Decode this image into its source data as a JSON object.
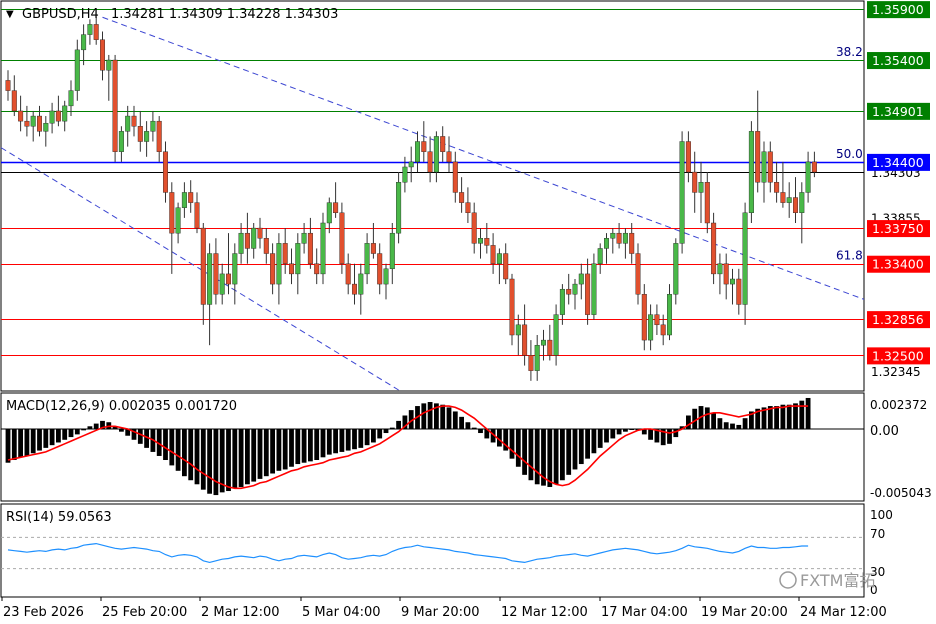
{
  "header": {
    "symbol_tf": "GBPUSD,H4",
    "ohlc": "1.34281 1.34309 1.34228 1.34303"
  },
  "macd_label": "MACD(12,26,9) 0.002035 0.001720",
  "rsi_label": "RSI(14) 59.0563",
  "watermark": "FXTM富拓",
  "colors": {
    "bull": "#49b848",
    "bear": "#e1502e",
    "support": "#ff0000",
    "resistance": "#008000",
    "fib": "#000080",
    "pivot": "#0000ff",
    "channel": "#3c46d2",
    "macd_signal": "#ff0000",
    "rsi_line": "#1e90ff"
  },
  "price_tags": [
    {
      "label": "1.35900",
      "price": 1.359,
      "color": "#008000"
    },
    {
      "label": "1.35400",
      "price": 1.354,
      "color": "#008000"
    },
    {
      "label": "1.34901",
      "price": 1.34901,
      "color": "#008000"
    },
    {
      "label": "1.34400",
      "price": 1.344,
      "color": "#0000ff"
    },
    {
      "label": "1.33750",
      "price": 1.3375,
      "color": "#ff0000"
    },
    {
      "label": "1.33400",
      "price": 1.334,
      "color": "#ff0000"
    },
    {
      "label": "1.32856",
      "price": 1.32856,
      "color": "#ff0000"
    },
    {
      "label": "1.32500",
      "price": 1.325,
      "color": "#ff0000"
    }
  ],
  "axis_prices": [
    {
      "label": "1.34303",
      "price": 1.34303
    },
    {
      "label": "1.33855",
      "price": 1.33855
    },
    {
      "label": "1.32345",
      "price": 1.32345
    }
  ],
  "fib_labels": [
    {
      "label": "38.2",
      "price": 1.354
    },
    {
      "label": "50.0",
      "price": 1.344
    },
    {
      "label": "61.8",
      "price": 1.334
    }
  ],
  "macd_axis": [
    "0.002372",
    "0.00",
    "-0.005043"
  ],
  "rsi_axis": [
    "100",
    "70",
    "30",
    "0"
  ],
  "x_labels": [
    "23 Feb 2026",
    "25 Feb 20:00",
    "2 Mar 12:00",
    "5 Mar 04:00",
    "9 Mar 20:00",
    "12 Mar 12:00",
    "17 Mar 04:00",
    "19 Mar 20:00",
    "24 Mar 12:00"
  ],
  "chart_data": {
    "type": "candlestick",
    "instrument": "GBPUSD",
    "timeframe": "H4",
    "price_range": [
      1.3216,
      1.3597
    ],
    "candles": [
      [
        1.352,
        1.353,
        1.35,
        1.351
      ],
      [
        1.351,
        1.3525,
        1.3485,
        1.349
      ],
      [
        1.349,
        1.3505,
        1.347,
        1.348
      ],
      [
        1.348,
        1.3495,
        1.3465,
        1.3475
      ],
      [
        1.3475,
        1.349,
        1.346,
        1.3485
      ],
      [
        1.3485,
        1.3495,
        1.3465,
        1.347
      ],
      [
        1.347,
        1.3485,
        1.3455,
        1.3478
      ],
      [
        1.3478,
        1.3498,
        1.3468,
        1.349
      ],
      [
        1.349,
        1.3505,
        1.3475,
        1.348
      ],
      [
        1.348,
        1.35,
        1.347,
        1.3495
      ],
      [
        1.3495,
        1.352,
        1.3485,
        1.351
      ],
      [
        1.351,
        1.356,
        1.35,
        1.355
      ],
      [
        1.355,
        1.3575,
        1.3535,
        1.3565
      ],
      [
        1.3565,
        1.358,
        1.3555,
        1.3575
      ],
      [
        1.3575,
        1.3582,
        1.3555,
        1.356
      ],
      [
        1.356,
        1.3568,
        1.352,
        1.353
      ],
      [
        1.353,
        1.3545,
        1.35,
        1.354
      ],
      [
        1.354,
        1.3545,
        1.344,
        1.345
      ],
      [
        1.345,
        1.3475,
        1.344,
        1.347
      ],
      [
        1.347,
        1.3495,
        1.3455,
        1.3485
      ],
      [
        1.3485,
        1.3495,
        1.3465,
        1.3475
      ],
      [
        1.3475,
        1.349,
        1.345,
        1.346
      ],
      [
        1.346,
        1.348,
        1.3445,
        1.347
      ],
      [
        1.347,
        1.349,
        1.346,
        1.348
      ],
      [
        1.348,
        1.3485,
        1.344,
        1.345
      ],
      [
        1.345,
        1.346,
        1.34,
        1.341
      ],
      [
        1.341,
        1.342,
        1.333,
        1.337
      ],
      [
        1.337,
        1.34,
        1.336,
        1.3395
      ],
      [
        1.3395,
        1.342,
        1.3385,
        1.341
      ],
      [
        1.341,
        1.3422,
        1.339,
        1.34
      ],
      [
        1.34,
        1.341,
        1.337,
        1.3375
      ],
      [
        1.3375,
        1.338,
        1.328,
        1.33
      ],
      [
        1.33,
        1.336,
        1.326,
        1.335
      ],
      [
        1.335,
        1.3365,
        1.33,
        1.331
      ],
      [
        1.331,
        1.334,
        1.33,
        1.333
      ],
      [
        1.333,
        1.337,
        1.331,
        1.332
      ],
      [
        1.332,
        1.336,
        1.33,
        1.335
      ],
      [
        1.335,
        1.338,
        1.334,
        1.337
      ],
      [
        1.337,
        1.339,
        1.334,
        1.3355
      ],
      [
        1.3355,
        1.338,
        1.3345,
        1.3375
      ],
      [
        1.3375,
        1.3385,
        1.3355,
        1.3365
      ],
      [
        1.3365,
        1.3375,
        1.334,
        1.335
      ],
      [
        1.335,
        1.336,
        1.331,
        1.332
      ],
      [
        1.332,
        1.337,
        1.33,
        1.336
      ],
      [
        1.336,
        1.3375,
        1.333,
        1.334
      ],
      [
        1.334,
        1.3355,
        1.332,
        1.333
      ],
      [
        1.333,
        1.337,
        1.331,
        1.336
      ],
      [
        1.336,
        1.338,
        1.335,
        1.337
      ],
      [
        1.337,
        1.3385,
        1.3335,
        1.334
      ],
      [
        1.334,
        1.3355,
        1.332,
        1.333
      ],
      [
        1.333,
        1.339,
        1.332,
        1.338
      ],
      [
        1.338,
        1.3405,
        1.337,
        1.34
      ],
      [
        1.34,
        1.342,
        1.3385,
        1.339
      ],
      [
        1.339,
        1.34,
        1.333,
        1.334
      ],
      [
        1.334,
        1.335,
        1.331,
        1.332
      ],
      [
        1.332,
        1.334,
        1.33,
        1.331
      ],
      [
        1.331,
        1.334,
        1.329,
        1.333
      ],
      [
        1.333,
        1.337,
        1.332,
        1.336
      ],
      [
        1.336,
        1.338,
        1.3345,
        1.335
      ],
      [
        1.335,
        1.336,
        1.331,
        1.332
      ],
      [
        1.332,
        1.334,
        1.3305,
        1.3335
      ],
      [
        1.3335,
        1.338,
        1.332,
        1.337
      ],
      [
        1.337,
        1.343,
        1.336,
        1.342
      ],
      [
        1.342,
        1.3445,
        1.341,
        1.3435
      ],
      [
        1.3435,
        1.3455,
        1.342,
        1.344
      ],
      [
        1.344,
        1.347,
        1.343,
        1.346
      ],
      [
        1.346,
        1.348,
        1.344,
        1.345
      ],
      [
        1.345,
        1.3465,
        1.342,
        1.343
      ],
      [
        1.343,
        1.347,
        1.342,
        1.3465
      ],
      [
        1.3465,
        1.3475,
        1.344,
        1.345
      ],
      [
        1.345,
        1.3465,
        1.343,
        1.344
      ],
      [
        1.344,
        1.345,
        1.34,
        1.341
      ],
      [
        1.341,
        1.3425,
        1.339,
        1.34
      ],
      [
        1.34,
        1.3415,
        1.338,
        1.339
      ],
      [
        1.339,
        1.34,
        1.335,
        1.336
      ],
      [
        1.336,
        1.3375,
        1.3345,
        1.3365
      ],
      [
        1.3365,
        1.338,
        1.335,
        1.3358
      ],
      [
        1.3358,
        1.337,
        1.333,
        1.334
      ],
      [
        1.334,
        1.3355,
        1.332,
        1.335
      ],
      [
        1.335,
        1.336,
        1.332,
        1.3325
      ],
      [
        1.3325,
        1.333,
        1.326,
        1.327
      ],
      [
        1.327,
        1.329,
        1.325,
        1.328
      ],
      [
        1.328,
        1.33,
        1.324,
        1.325
      ],
      [
        1.325,
        1.3265,
        1.3225,
        1.3235
      ],
      [
        1.3235,
        1.327,
        1.3225,
        1.326
      ],
      [
        1.326,
        1.3275,
        1.3245,
        1.3265
      ],
      [
        1.3265,
        1.328,
        1.3245,
        1.325
      ],
      [
        1.325,
        1.33,
        1.324,
        1.329
      ],
      [
        1.329,
        1.332,
        1.328,
        1.3315
      ],
      [
        1.3315,
        1.333,
        1.33,
        1.331
      ],
      [
        1.331,
        1.3325,
        1.3295,
        1.332
      ],
      [
        1.332,
        1.334,
        1.3305,
        1.333
      ],
      [
        1.333,
        1.3345,
        1.328,
        1.329
      ],
      [
        1.329,
        1.335,
        1.3285,
        1.334
      ],
      [
        1.334,
        1.336,
        1.333,
        1.3355
      ],
      [
        1.3355,
        1.337,
        1.334,
        1.3365
      ],
      [
        1.3365,
        1.3375,
        1.335,
        1.337
      ],
      [
        1.337,
        1.338,
        1.3355,
        1.336
      ],
      [
        1.336,
        1.3375,
        1.3345,
        1.337
      ],
      [
        1.337,
        1.338,
        1.334,
        1.335
      ],
      [
        1.335,
        1.336,
        1.33,
        1.331
      ],
      [
        1.331,
        1.332,
        1.3255,
        1.3265
      ],
      [
        1.3265,
        1.33,
        1.3255,
        1.329
      ],
      [
        1.329,
        1.33,
        1.327,
        1.328
      ],
      [
        1.328,
        1.329,
        1.326,
        1.327
      ],
      [
        1.327,
        1.332,
        1.3265,
        1.331
      ],
      [
        1.331,
        1.3365,
        1.33,
        1.336
      ],
      [
        1.336,
        1.347,
        1.335,
        1.346
      ],
      [
        1.346,
        1.347,
        1.342,
        1.343
      ],
      [
        1.343,
        1.345,
        1.339,
        1.341
      ],
      [
        1.341,
        1.344,
        1.338,
        1.342
      ],
      [
        1.342,
        1.343,
        1.337,
        1.338
      ],
      [
        1.338,
        1.339,
        1.332,
        1.333
      ],
      [
        1.333,
        1.335,
        1.331,
        1.334
      ],
      [
        1.334,
        1.335,
        1.3305,
        1.332
      ],
      [
        1.332,
        1.3335,
        1.33,
        1.3325
      ],
      [
        1.3325,
        1.3335,
        1.329,
        1.33
      ],
      [
        1.33,
        1.34,
        1.328,
        1.339
      ],
      [
        1.339,
        1.348,
        1.338,
        1.347
      ],
      [
        1.347,
        1.351,
        1.341,
        1.342
      ],
      [
        1.342,
        1.346,
        1.34,
        1.345
      ],
      [
        1.345,
        1.346,
        1.341,
        1.342
      ],
      [
        1.342,
        1.344,
        1.34,
        1.341
      ],
      [
        1.341,
        1.344,
        1.3395,
        1.34
      ],
      [
        1.34,
        1.342,
        1.3385,
        1.3405
      ],
      [
        1.3405,
        1.3425,
        1.338,
        1.339
      ],
      [
        1.339,
        1.342,
        1.336,
        1.341
      ],
      [
        1.341,
        1.345,
        1.34,
        1.344
      ],
      [
        1.344,
        1.345,
        1.3425,
        1.343
      ]
    ],
    "horizontal_levels": [
      1.359,
      1.354,
      1.34901,
      1.344,
      1.3375,
      1.334,
      1.32856,
      1.325
    ],
    "fibonacci": {
      "38.2": 1.354,
      "50.0": 1.344,
      "61.8": 1.334
    },
    "macd": {
      "label": "MACD(12,26,9)",
      "histogram": [
        -0.0025,
        -0.0023,
        -0.0021,
        -0.002,
        -0.0018,
        -0.0016,
        -0.0014,
        -0.0012,
        -0.001,
        -0.0008,
        -0.0006,
        -0.0004,
        -0.0001,
        0.0002,
        0.0004,
        0.0006,
        0.0005,
        0.0002,
        -0.0002,
        -0.0005,
        -0.0008,
        -0.0011,
        -0.0014,
        -0.0017,
        -0.002,
        -0.0023,
        -0.0027,
        -0.0031,
        -0.0035,
        -0.0038,
        -0.0041,
        -0.0045,
        -0.0048,
        -0.0049,
        -0.0047,
        -0.0046,
        -0.0044,
        -0.0043,
        -0.0041,
        -0.0039,
        -0.0037,
        -0.0035,
        -0.0033,
        -0.0031,
        -0.003,
        -0.0028,
        -0.0026,
        -0.0025,
        -0.0024,
        -0.0023,
        -0.0021,
        -0.0019,
        -0.0018,
        -0.0017,
        -0.0016,
        -0.0015,
        -0.0014,
        -0.0012,
        -0.001,
        -0.0007,
        -0.0003,
        0.0001,
        0.0006,
        0.001,
        0.0014,
        0.0017,
        0.0019,
        0.002,
        0.0019,
        0.0018,
        0.0016,
        0.0013,
        0.0009,
        0.0005,
        0.0001,
        -0.0003,
        -0.0007,
        -0.001,
        -0.0013,
        -0.0016,
        -0.0022,
        -0.0028,
        -0.0034,
        -0.0038,
        -0.0041,
        -0.0042,
        -0.0043,
        -0.0041,
        -0.0038,
        -0.0034,
        -0.003,
        -0.0026,
        -0.0022,
        -0.0018,
        -0.0014,
        -0.001,
        -0.0007,
        -0.0004,
        -0.0002,
        0.0,
        -0.0001,
        -0.0004,
        -0.0008,
        -0.001,
        -0.0012,
        -0.0011,
        -0.0006,
        0.0002,
        0.001,
        0.0015,
        0.0017,
        0.0016,
        0.0012,
        0.0008,
        0.0005,
        0.0004,
        0.0003,
        0.0008,
        0.0013,
        0.0015,
        0.0016,
        0.0017,
        0.0017,
        0.0018,
        0.0018,
        0.0019,
        0.0021,
        0.0023
      ],
      "signal": [
        -0.0023,
        -0.0022,
        -0.0021,
        -0.002,
        -0.0019,
        -0.0018,
        -0.0017,
        -0.0015,
        -0.0013,
        -0.0011,
        -0.0009,
        -0.0007,
        -0.0005,
        -0.0003,
        -0.0001,
        0.0001,
        0.0002,
        0.0002,
        0.0001,
        0.0,
        -0.0002,
        -0.0004,
        -0.0006,
        -0.0008,
        -0.0011,
        -0.0014,
        -0.0017,
        -0.002,
        -0.0023,
        -0.0026,
        -0.003,
        -0.0033,
        -0.0036,
        -0.0039,
        -0.0041,
        -0.0043,
        -0.0044,
        -0.0044,
        -0.0043,
        -0.0042,
        -0.004,
        -0.0039,
        -0.0037,
        -0.0035,
        -0.0033,
        -0.0031,
        -0.003,
        -0.0028,
        -0.0027,
        -0.0026,
        -0.0025,
        -0.0023,
        -0.0022,
        -0.0021,
        -0.002,
        -0.0018,
        -0.0017,
        -0.0015,
        -0.0013,
        -0.0011,
        -0.0008,
        -0.0005,
        -0.0002,
        0.0002,
        0.0006,
        0.0009,
        0.0012,
        0.0014,
        0.0016,
        0.0017,
        0.0017,
        0.0016,
        0.0014,
        0.0011,
        0.0008,
        0.0004,
        0.0,
        -0.0004,
        -0.0008,
        -0.0012,
        -0.0016,
        -0.002,
        -0.0024,
        -0.0028,
        -0.0032,
        -0.0036,
        -0.0039,
        -0.0041,
        -0.0042,
        -0.0041,
        -0.0038,
        -0.0034,
        -0.003,
        -0.0025,
        -0.002,
        -0.0016,
        -0.0012,
        -0.0008,
        -0.0005,
        -0.0003,
        -0.0001,
        0.0,
        0.0,
        -0.0001,
        -0.0002,
        -0.0003,
        -0.0002,
        0.0,
        0.0003,
        0.0006,
        0.0009,
        0.0011,
        0.0012,
        0.0012,
        0.0011,
        0.001,
        0.0009,
        0.001,
        0.0011,
        0.0013,
        0.0014,
        0.0015,
        0.0016,
        0.0016,
        0.0017,
        0.0017,
        0.0017,
        0.0017
      ],
      "ylim": [
        -0.005043,
        0.002372
      ]
    },
    "rsi": {
      "label": "RSI(14)",
      "values": [
        54,
        53,
        52,
        51,
        52,
        53,
        52,
        54,
        55,
        54,
        56,
        57,
        60,
        61,
        62,
        60,
        58,
        56,
        55,
        56,
        57,
        56,
        55,
        53,
        52,
        48,
        45,
        47,
        48,
        47,
        45,
        40,
        38,
        40,
        42,
        43,
        45,
        46,
        45,
        44,
        46,
        45,
        42,
        40,
        42,
        43,
        46,
        47,
        46,
        45,
        48,
        50,
        48,
        44,
        42,
        43,
        44,
        46,
        47,
        46,
        48,
        52,
        55,
        57,
        58,
        60,
        58,
        57,
        56,
        55,
        54,
        52,
        51,
        50,
        48,
        47,
        46,
        45,
        44,
        43,
        40,
        39,
        38,
        40,
        42,
        43,
        44,
        46,
        47,
        48,
        49,
        47,
        46,
        48,
        50,
        52,
        54,
        55,
        56,
        55,
        54,
        52,
        50,
        49,
        50,
        51,
        53,
        56,
        60,
        58,
        57,
        56,
        54,
        52,
        51,
        50,
        52,
        56,
        59,
        57,
        57,
        56,
        56,
        57,
        57,
        58,
        59,
        59
      ],
      "levels": [
        70,
        30
      ],
      "ylim": [
        0,
        100
      ]
    }
  }
}
